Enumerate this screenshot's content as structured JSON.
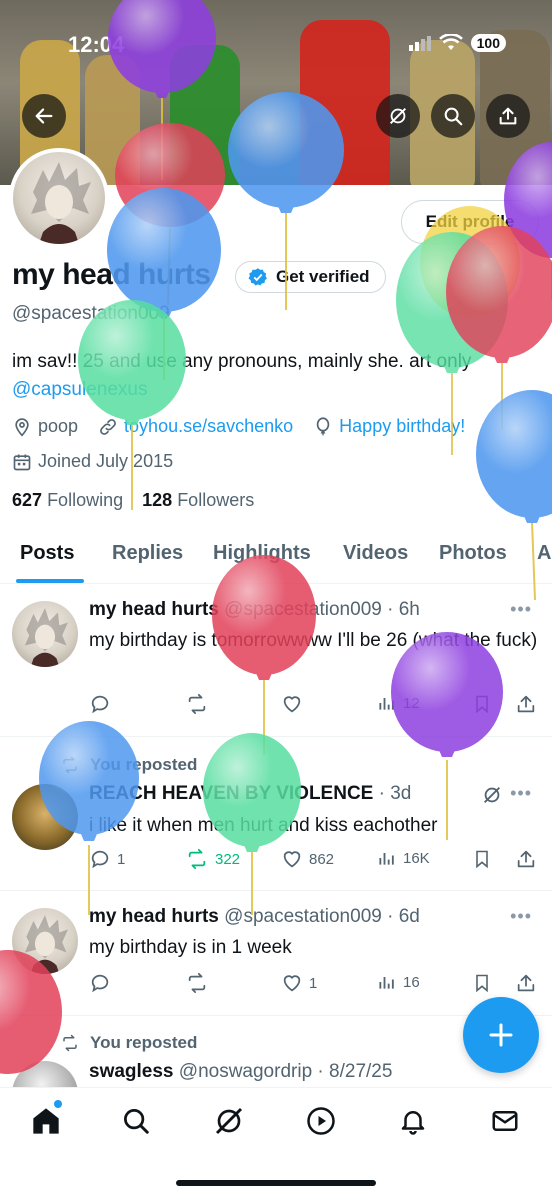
{
  "status_bar": {
    "time": "12:04",
    "battery": "100"
  },
  "header": {
    "back_icon": "arrow-left-icon",
    "grok_icon": "grok-icon",
    "search_icon": "search-icon",
    "share_icon": "share-icon",
    "edit_profile_label": "Edit profile"
  },
  "profile": {
    "display_name": "my head hurts",
    "get_verified_label": "Get verified",
    "handle": "@spacestation009",
    "bio_text": "im sav!! 25 and use any pronouns, mainly she. art only",
    "bio_mention": "@capsulenexus",
    "location": "poop",
    "website": "toyhou.se/savchenko",
    "birthday": "Happy birthday!",
    "joined": "Joined July 2015",
    "following_count": "627",
    "following_label": "Following",
    "followers_count": "128",
    "followers_label": "Followers"
  },
  "tabs": [
    "Posts",
    "Replies",
    "Highlights",
    "Videos",
    "Photos",
    "A"
  ],
  "tweets": [
    {
      "name": "my head hurts",
      "handle": "@spacestation009",
      "time": "6h",
      "text": "my birthday is tomorrowwww I'll be 26 (what the fuck)",
      "views": "12"
    },
    {
      "repost_note": "You reposted",
      "name": "REACH HEAVEN BY VIOLENCE",
      "time": "3d",
      "text": "i like it when men hurt and kiss eachother",
      "replies": "1",
      "reposts": "322",
      "likes": "862",
      "views": "16K"
    },
    {
      "name": "my head hurts",
      "handle": "@spacestation009",
      "time": "6d",
      "text": "my birthday is in 1 week",
      "likes": "1",
      "views": "16"
    },
    {
      "repost_note": "You reposted",
      "name": "swagless",
      "handle": "@noswagordrip",
      "time": "8/27/25"
    }
  ],
  "fab": {
    "icon": "plus-icon"
  },
  "bottom_nav": [
    "home-icon",
    "search-icon",
    "grok-icon",
    "play-icon",
    "bell-icon",
    "mail-icon"
  ],
  "colors": {
    "accent": "#1d9bf0",
    "repost_green": "#00ba7c",
    "balloon_purple": "#8e3fe0",
    "balloon_blue": "#4f98ef",
    "balloon_red": "#e2415a",
    "balloon_green": "#56dea0",
    "balloon_yellow": "#f2d23f"
  }
}
